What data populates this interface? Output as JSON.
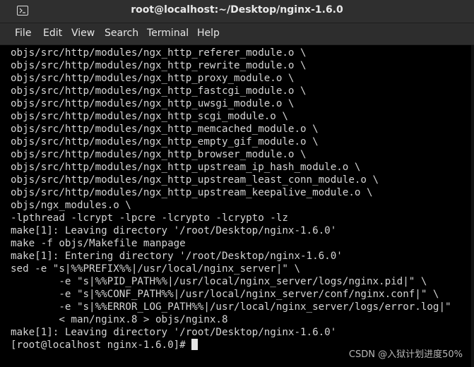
{
  "window": {
    "title": "root@localhost:~/Desktop/nginx-1.6.0",
    "icon": "terminal-icon"
  },
  "menu": {
    "file": "File",
    "edit": "Edit",
    "view": "View",
    "search": "Search",
    "terminal": "Terminal",
    "help": "Help"
  },
  "terminal": {
    "lines": [
      "objs/src/http/modules/ngx_http_referer_module.o \\",
      "objs/src/http/modules/ngx_http_rewrite_module.o \\",
      "objs/src/http/modules/ngx_http_proxy_module.o \\",
      "objs/src/http/modules/ngx_http_fastcgi_module.o \\",
      "objs/src/http/modules/ngx_http_uwsgi_module.o \\",
      "objs/src/http/modules/ngx_http_scgi_module.o \\",
      "objs/src/http/modules/ngx_http_memcached_module.o \\",
      "objs/src/http/modules/ngx_http_empty_gif_module.o \\",
      "objs/src/http/modules/ngx_http_browser_module.o \\",
      "objs/src/http/modules/ngx_http_upstream_ip_hash_module.o \\",
      "objs/src/http/modules/ngx_http_upstream_least_conn_module.o \\",
      "objs/src/http/modules/ngx_http_upstream_keepalive_module.o \\",
      "objs/ngx_modules.o \\",
      "-lpthread -lcrypt -lpcre -lcrypto -lcrypto -lz",
      "make[1]: Leaving directory '/root/Desktop/nginx-1.6.0'",
      "make -f objs/Makefile manpage",
      "make[1]: Entering directory '/root/Desktop/nginx-1.6.0'",
      "sed -e \"s|%%PREFIX%%|/usr/local/nginx_server|\" \\",
      "        -e \"s|%%PID_PATH%%|/usr/local/nginx_server/logs/nginx.pid|\" \\",
      "        -e \"s|%%CONF_PATH%%|/usr/local/nginx_server/conf/nginx.conf|\" \\",
      "        -e \"s|%%ERROR_LOG_PATH%%|/usr/local/nginx_server/logs/error.log|\"",
      "        < man/nginx.8 > objs/nginx.8",
      "make[1]: Leaving directory '/root/Desktop/nginx-1.6.0'"
    ],
    "prompt": "[root@localhost nginx-1.6.0]#"
  },
  "watermark": "CSDN @入狱计划进度50%"
}
